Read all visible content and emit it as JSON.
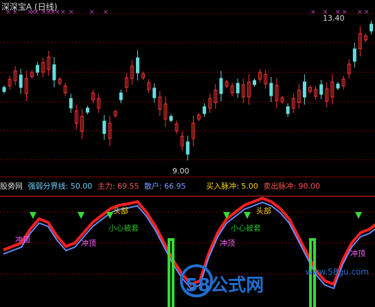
{
  "header": {
    "title": "深深宝A (日线)"
  },
  "price_labels": {
    "high": "13.40",
    "low": "9.00"
  },
  "indicator": {
    "name": "股旁网",
    "strength_line": "强弱分界线: 50.00",
    "main_force": "主力: 69.55",
    "retail": "散户: 66.95",
    "buy_pulse": "买入脉冲: 5.00",
    "sell_pulse": "卖出脉冲: 90.00"
  },
  "annotations": {
    "head1": "头部",
    "head2": "头部",
    "careful1": "小心被套",
    "careful2": "小心被套",
    "top1": "冲顶",
    "top2": "冲顶",
    "top3": "冲顶"
  },
  "watermark": {
    "brand": "58公式网",
    "url": "www.58gu.com"
  },
  "colors": {
    "up": "#ff3333",
    "down": "#66dddd",
    "main_line": "#ff2020",
    "retail_line": "#6a8cff",
    "pulse": "#33dd33",
    "grid": "#8b0000",
    "marker": "#cc44cc"
  }
}
